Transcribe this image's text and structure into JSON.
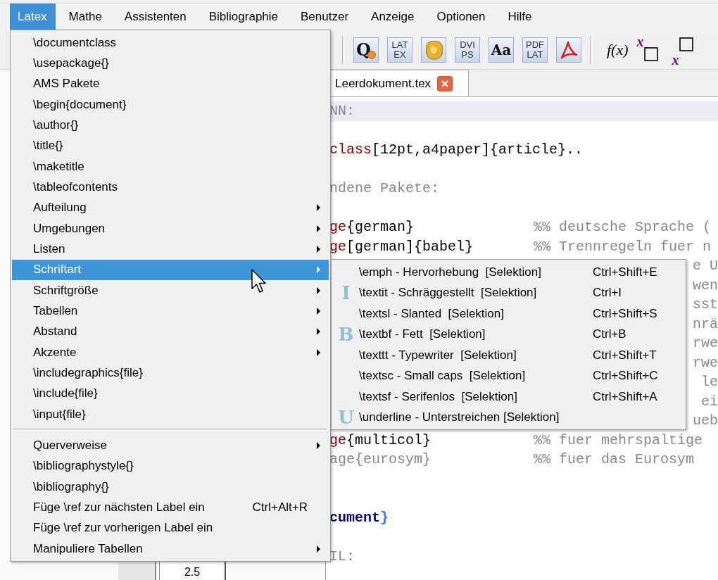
{
  "menubar": [
    {
      "label": "Latex",
      "selected": true
    },
    {
      "label": "Mathe",
      "selected": false
    },
    {
      "label": "Assistenten",
      "selected": false
    },
    {
      "label": "Bibliographie",
      "selected": false
    },
    {
      "label": "Benutzer",
      "selected": false
    },
    {
      "label": "Anzeige",
      "selected": false
    },
    {
      "label": "Optionen",
      "selected": false
    },
    {
      "label": "Hilfe",
      "selected": false
    }
  ],
  "toolbar": [
    {
      "kind": "separator"
    },
    {
      "kind": "query",
      "label": "Q"
    },
    {
      "kind": "stack",
      "lines": [
        "LAT",
        "EX"
      ]
    },
    {
      "kind": "blot"
    },
    {
      "kind": "stack",
      "lines": [
        "DVI",
        "PS"
      ]
    },
    {
      "kind": "serif",
      "label": "Aa"
    },
    {
      "kind": "stack",
      "lines": [
        "PDF",
        "LAT"
      ]
    },
    {
      "kind": "pdf"
    },
    {
      "kind": "separator"
    },
    {
      "kind": "formula",
      "label": "f(x)"
    },
    {
      "kind": "sup",
      "label": "x"
    },
    {
      "kind": "sub",
      "label": "x"
    }
  ],
  "tabs": [
    {
      "label": "Leerdokument.tex",
      "selected": true
    }
  ],
  "editor": {
    "lines": [
      {
        "kind": "line",
        "current": true,
        "code": [
          {
            "text": "NN:",
            "kind": "comment"
          }
        ]
      },
      {
        "kind": "blank",
        "current": false
      },
      {
        "kind": "line",
        "current": false,
        "code": [
          {
            "text": "class",
            "kind": "keyword"
          },
          {
            "text": "[12pt,a4paper]{article}..",
            "kind": "plain"
          }
        ]
      },
      {
        "kind": "blank",
        "current": false
      },
      {
        "kind": "line",
        "current": false,
        "code": [
          {
            "text": "ndene Pakete:",
            "kind": "comment"
          }
        ]
      },
      {
        "kind": "blank",
        "current": false
      },
      {
        "kind": "line",
        "current": false,
        "code": [
          {
            "text": "ge",
            "kind": "keyword"
          },
          {
            "text": "{german}",
            "kind": "plain"
          }
        ],
        "comment": "%% deutsche Sprache ("
      },
      {
        "kind": "line",
        "current": false,
        "code": [
          {
            "text": "ge",
            "kind": "keyword"
          },
          {
            "text": "[german]{babel}",
            "kind": "plain"
          }
        ],
        "comment": "%% Trennregeln fuer n"
      },
      {
        "kind": "tail",
        "current": false,
        "code": [
          {
            "text": "e U",
            "kind": "comment"
          }
        ]
      },
      {
        "kind": "tail",
        "current": false,
        "code": [
          {
            "text": "wen",
            "kind": "comment"
          }
        ]
      },
      {
        "kind": "tail",
        "current": false,
        "code": [
          {
            "text": "sst",
            "kind": "comment"
          }
        ]
      },
      {
        "kind": "tail",
        "current": false,
        "code": [
          {
            "text": "nrä",
            "kind": "comment"
          }
        ]
      },
      {
        "kind": "tail",
        "current": false,
        "code": [
          {
            "text": "rwe",
            "kind": "comment"
          }
        ]
      },
      {
        "kind": "tail",
        "current": false,
        "code": [
          {
            "text": "rwe",
            "kind": "comment"
          }
        ]
      },
      {
        "kind": "tail",
        "current": false,
        "code": [
          {
            "text": "le",
            "kind": "comment"
          }
        ]
      },
      {
        "kind": "tail",
        "current": false,
        "code": [
          {
            "text": "ei",
            "kind": "comment"
          }
        ]
      },
      {
        "kind": "tail",
        "current": false,
        "code": [
          {
            "text": "ueb",
            "kind": "comment"
          }
        ]
      },
      {
        "kind": "line",
        "current": false,
        "code": [
          {
            "text": "ge",
            "kind": "keyword"
          },
          {
            "text": "{multicol}",
            "kind": "plain"
          }
        ],
        "comment": "%% fuer mehrspaltige"
      },
      {
        "kind": "line",
        "current": false,
        "code": [
          {
            "text": "age{eurosym}",
            "kind": "comment"
          }
        ],
        "comment": "%% fuer das Eurosym"
      },
      {
        "kind": "blank",
        "current": false
      },
      {
        "kind": "blank",
        "current": false
      },
      {
        "kind": "line",
        "current": false,
        "code": [
          {
            "text": "cument",
            "kind": "env"
          },
          {
            "text": "}",
            "kind": "brace"
          }
        ]
      },
      {
        "kind": "blank",
        "current": false
      },
      {
        "kind": "line",
        "current": false,
        "code": [
          {
            "text": "IL:",
            "kind": "comment"
          }
        ]
      }
    ]
  },
  "structure_panel": {
    "cell": "2.5"
  },
  "menu": {
    "items": [
      {
        "kind": "item",
        "label": "\\documentclass",
        "selected": false,
        "submenu": false
      },
      {
        "kind": "item",
        "label": "\\usepackage{}",
        "selected": false,
        "submenu": false
      },
      {
        "kind": "item",
        "label": "AMS Pakete",
        "selected": false,
        "submenu": false
      },
      {
        "kind": "item",
        "label": "\\begin{document}",
        "selected": false,
        "submenu": false
      },
      {
        "kind": "item",
        "label": "\\author{}",
        "selected": false,
        "submenu": false
      },
      {
        "kind": "item",
        "label": "\\title{}",
        "selected": false,
        "submenu": false
      },
      {
        "kind": "item",
        "label": "\\maketitle",
        "selected": false,
        "submenu": false
      },
      {
        "kind": "item",
        "label": "\\tableofcontents",
        "selected": false,
        "submenu": false
      },
      {
        "kind": "item",
        "label": "Aufteilung",
        "selected": false,
        "submenu": true
      },
      {
        "kind": "item",
        "label": "Umgebungen",
        "selected": false,
        "submenu": true
      },
      {
        "kind": "item",
        "label": "Listen",
        "selected": false,
        "submenu": true
      },
      {
        "kind": "item",
        "label": "Schriftart",
        "selected": true,
        "submenu": true
      },
      {
        "kind": "item",
        "label": "Schriftgröße",
        "selected": false,
        "submenu": true
      },
      {
        "kind": "item",
        "label": "Tabellen",
        "selected": false,
        "submenu": true
      },
      {
        "kind": "item",
        "label": "Abstand",
        "selected": false,
        "submenu": true
      },
      {
        "kind": "item",
        "label": "Akzente",
        "selected": false,
        "submenu": true
      },
      {
        "kind": "item",
        "label": "\\includegraphics{file}",
        "selected": false,
        "submenu": false
      },
      {
        "kind": "item",
        "label": "\\include{file}",
        "selected": false,
        "submenu": false
      },
      {
        "kind": "item",
        "label": "\\input{file}",
        "selected": false,
        "submenu": false
      },
      {
        "kind": "separator"
      },
      {
        "kind": "item",
        "label": "Querverweise",
        "selected": false,
        "submenu": true
      },
      {
        "kind": "item",
        "label": "\\bibliographystyle{}",
        "selected": false,
        "submenu": false
      },
      {
        "kind": "item",
        "label": "\\bibliography{}",
        "selected": false,
        "submenu": false
      },
      {
        "kind": "item",
        "label": "Füge \\ref zur nächsten Label ein",
        "shortcut": "Ctrl+Alt+R",
        "selected": false,
        "submenu": false
      },
      {
        "kind": "item",
        "label": "Füge \\ref zur vorherigen Label ein",
        "selected": false,
        "submenu": false
      },
      {
        "kind": "item",
        "label": "Manipuliere Tabellen",
        "selected": false,
        "submenu": true
      }
    ]
  },
  "submenu": {
    "items": [
      {
        "label": "\\emph - Hervorhebung  [Selektion]",
        "shortcut": "Ctrl+Shift+E",
        "selected": false
      },
      {
        "icon": "I",
        "label": "\\textit - Schräggestellt  [Selektion]",
        "shortcut": "Ctrl+I",
        "selected": false
      },
      {
        "label": "\\textsl - Slanted  [Selektion]",
        "shortcut": "Ctrl+Shift+S",
        "selected": false
      },
      {
        "icon": "B",
        "label": "\\textbf - Fett  [Selektion]",
        "shortcut": "Ctrl+B",
        "selected": false
      },
      {
        "label": "\\texttt - Typewriter  [Selektion]",
        "shortcut": "Ctrl+Shift+T",
        "selected": false
      },
      {
        "label": "\\textsc - Small caps  [Selektion]",
        "shortcut": "Ctrl+Shift+C",
        "selected": false
      },
      {
        "label": "\\textsf - Serifenlos  [Selektion]",
        "shortcut": "Ctrl+Shift+A",
        "selected": false
      },
      {
        "icon": "U",
        "label": "\\underline - Unterstreichen [Selektion]",
        "selected": false
      }
    ]
  }
}
